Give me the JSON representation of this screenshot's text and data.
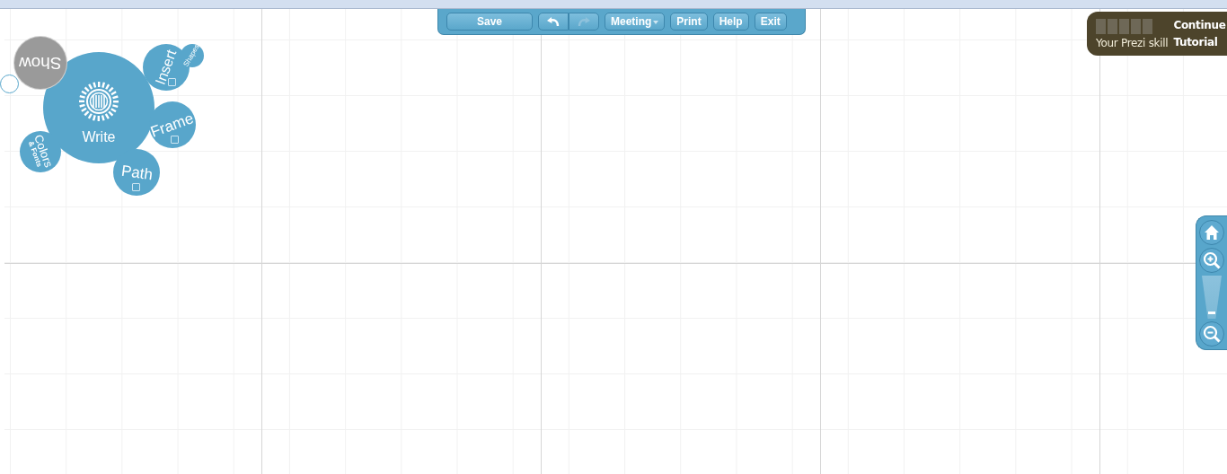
{
  "toolbar": {
    "buttons": [
      {
        "kind": "text",
        "label": "Save",
        "disabled": false
      },
      {
        "kind": "undo",
        "disabled": false
      },
      {
        "kind": "redo",
        "disabled": true
      },
      {
        "kind": "menu",
        "label": "Meeting",
        "disabled": false
      },
      {
        "kind": "text",
        "label": "Print",
        "disabled": false
      },
      {
        "kind": "text",
        "label": "Help",
        "disabled": false
      },
      {
        "kind": "text",
        "label": "Exit",
        "disabled": false
      }
    ]
  },
  "bubble_menu": {
    "center": {
      "label": "Write"
    },
    "bubbles": [
      {
        "label": "Show",
        "highlighted": true
      },
      {
        "label": "Insert",
        "highlighted": false
      },
      {
        "label": "Shapes",
        "highlighted": false
      },
      {
        "label": "Frame",
        "highlighted": false
      },
      {
        "label": "Path",
        "highlighted": false
      },
      {
        "label": "Colors",
        "sublabel": "& Fonts",
        "highlighted": false
      }
    ]
  },
  "skill": {
    "label": "Your Prezi skill",
    "action": "Continue Tutorial"
  },
  "zoom": {
    "level": 0.1
  }
}
